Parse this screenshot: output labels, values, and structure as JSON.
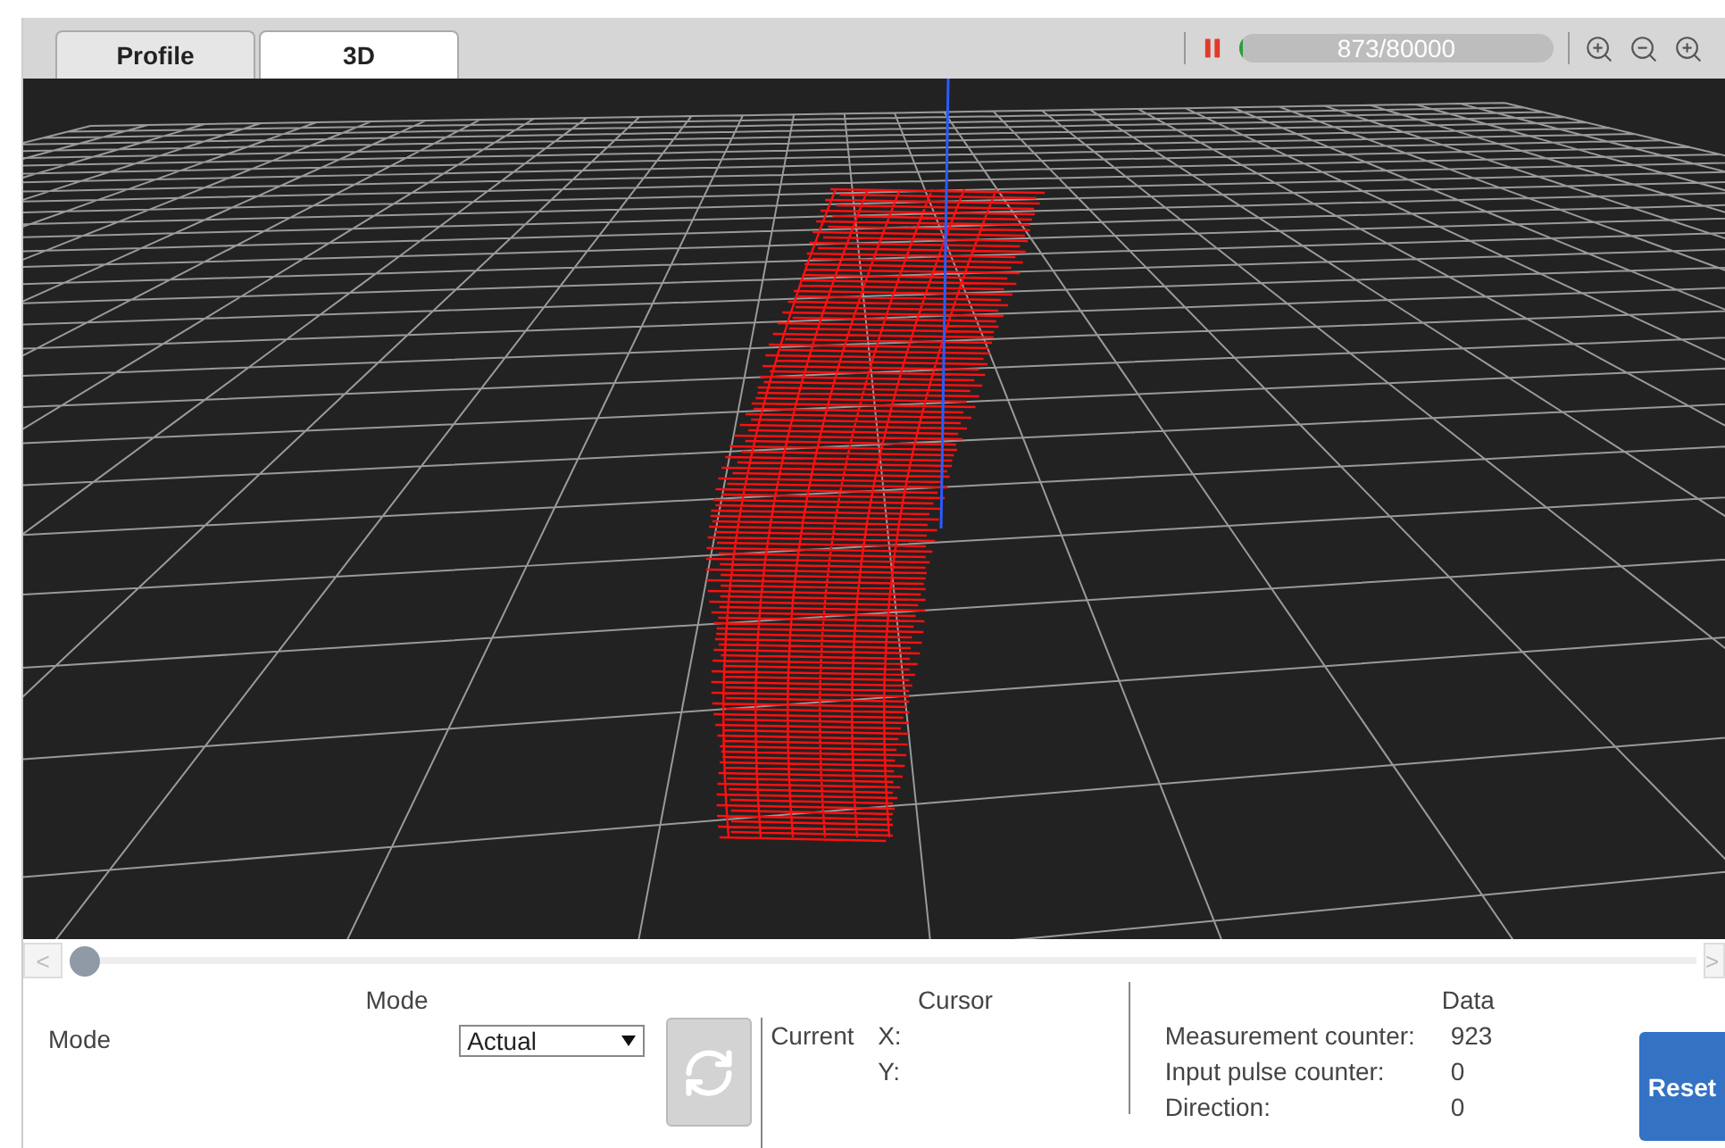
{
  "tabs": [
    {
      "label": "Profile",
      "selected": false
    },
    {
      "label": "3D",
      "selected": true
    }
  ],
  "toolbar": {
    "paused": true,
    "progress": {
      "level": 0.011,
      "text": "873/80000"
    }
  },
  "slider": {
    "prev_label": "<",
    "next_label": ">",
    "level": 0
  },
  "mode_section": {
    "title": "Mode",
    "label": "Mode",
    "select_value": "Actual",
    "refresh_disabled": true
  },
  "cursor_section": {
    "title": "Cursor",
    "label": "Current",
    "rows": [
      {
        "label": "X:"
      },
      {
        "label": "Y:"
      }
    ]
  },
  "data_section": {
    "title": "Data",
    "rows": [
      {
        "label": "Measurement counter:",
        "value": "923"
      },
      {
        "label": "Input pulse counter:",
        "value": "0"
      },
      {
        "label": "Direction:",
        "value": "0"
      }
    ]
  },
  "reset_button": {
    "label": "Reset"
  }
}
